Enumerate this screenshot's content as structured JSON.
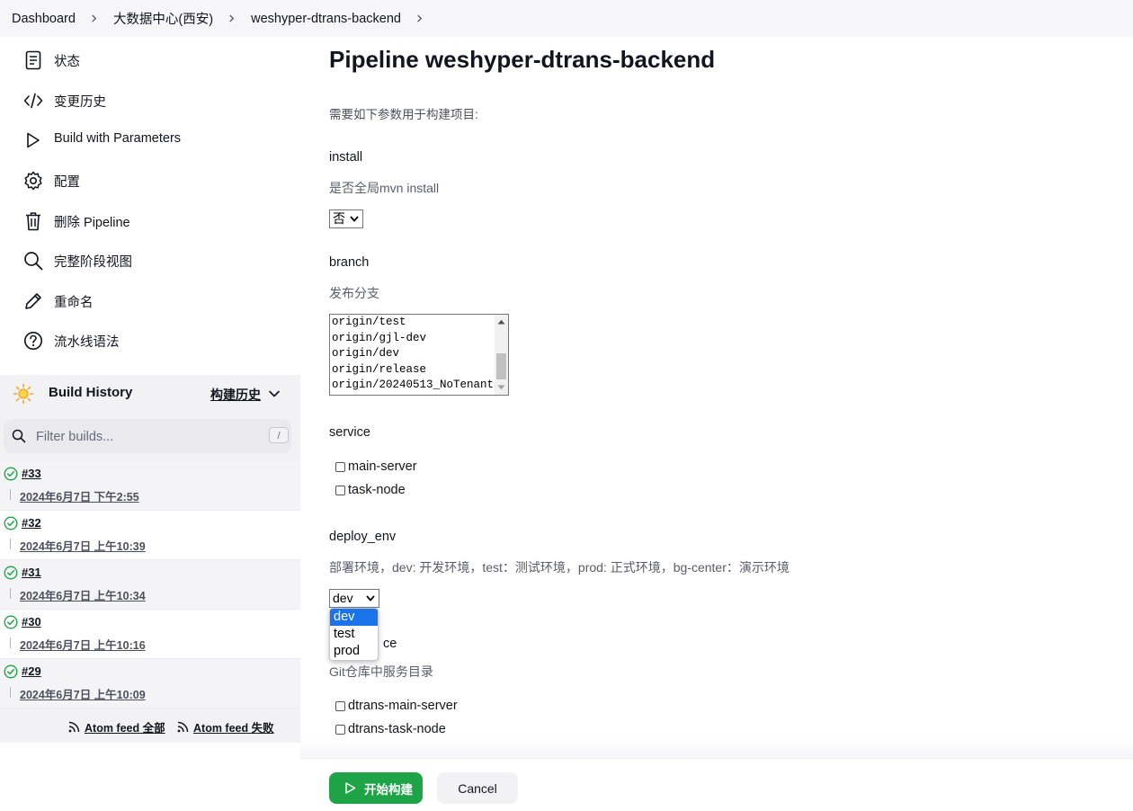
{
  "breadcrumb": [
    "Dashboard",
    "大数据中心(西安)",
    "weshyper-dtrans-backend"
  ],
  "sidebar": {
    "tasks": [
      {
        "label": "状态",
        "icon": "document-icon"
      },
      {
        "label": "变更历史",
        "icon": "code-icon"
      },
      {
        "label": "Build with Parameters",
        "icon": "play-icon"
      },
      {
        "label": "配置",
        "icon": "gear-icon"
      },
      {
        "label": "删除 Pipeline",
        "icon": "trash-icon"
      },
      {
        "label": "完整阶段视图",
        "icon": "search-icon"
      },
      {
        "label": "重命名",
        "icon": "pencil-icon"
      },
      {
        "label": "流水线语法",
        "icon": "help-icon"
      }
    ],
    "build_history": {
      "title": "Build History",
      "trend_label": "构建历史",
      "filter_placeholder": "Filter builds...",
      "filter_shortcut": "/",
      "builds": [
        {
          "number": "#33",
          "date": "2024年6月7日 下午2:55"
        },
        {
          "number": "#32",
          "date": "2024年6月7日 上午10:39"
        },
        {
          "number": "#31",
          "date": "2024年6月7日 上午10:34"
        },
        {
          "number": "#30",
          "date": "2024年6月7日 上午10:16"
        },
        {
          "number": "#29",
          "date": "2024年6月7日 上午10:09"
        }
      ],
      "feed_all": "Atom feed 全部",
      "feed_failed": "Atom feed 失败"
    }
  },
  "main": {
    "title": "Pipeline weshyper-dtrans-backend",
    "intro": "需要如下参数用于构建项目:",
    "params": {
      "install": {
        "name": "install",
        "desc": "是否全局mvn install",
        "value": "否"
      },
      "branch": {
        "name": "branch",
        "desc": "发布分支",
        "options": [
          "origin/test",
          "origin/gjl-dev",
          "origin/dev",
          "origin/release",
          "origin/20240513_NoTenant"
        ]
      },
      "service": {
        "name": "service",
        "options": [
          "main-server",
          "task-node"
        ]
      },
      "deploy_env": {
        "name": "deploy_env",
        "desc": "部署环境，dev: 开发环境，test：测试环境，prod: 正式环境，bg-center：演示环境",
        "value": "dev",
        "options": [
          "dev",
          "test",
          "prod"
        ]
      },
      "service_dir": {
        "name_tail": "ce",
        "desc": "Git仓库中服务目录",
        "options": [
          "dtrans-main-server",
          "dtrans-task-node"
        ]
      }
    }
  },
  "footer": {
    "build_label": "开始构建",
    "cancel_label": "Cancel"
  },
  "colors": {
    "primary_green": "#1ea446",
    "selected_blue": "#1a73e8",
    "success_green": "#1ea446"
  }
}
